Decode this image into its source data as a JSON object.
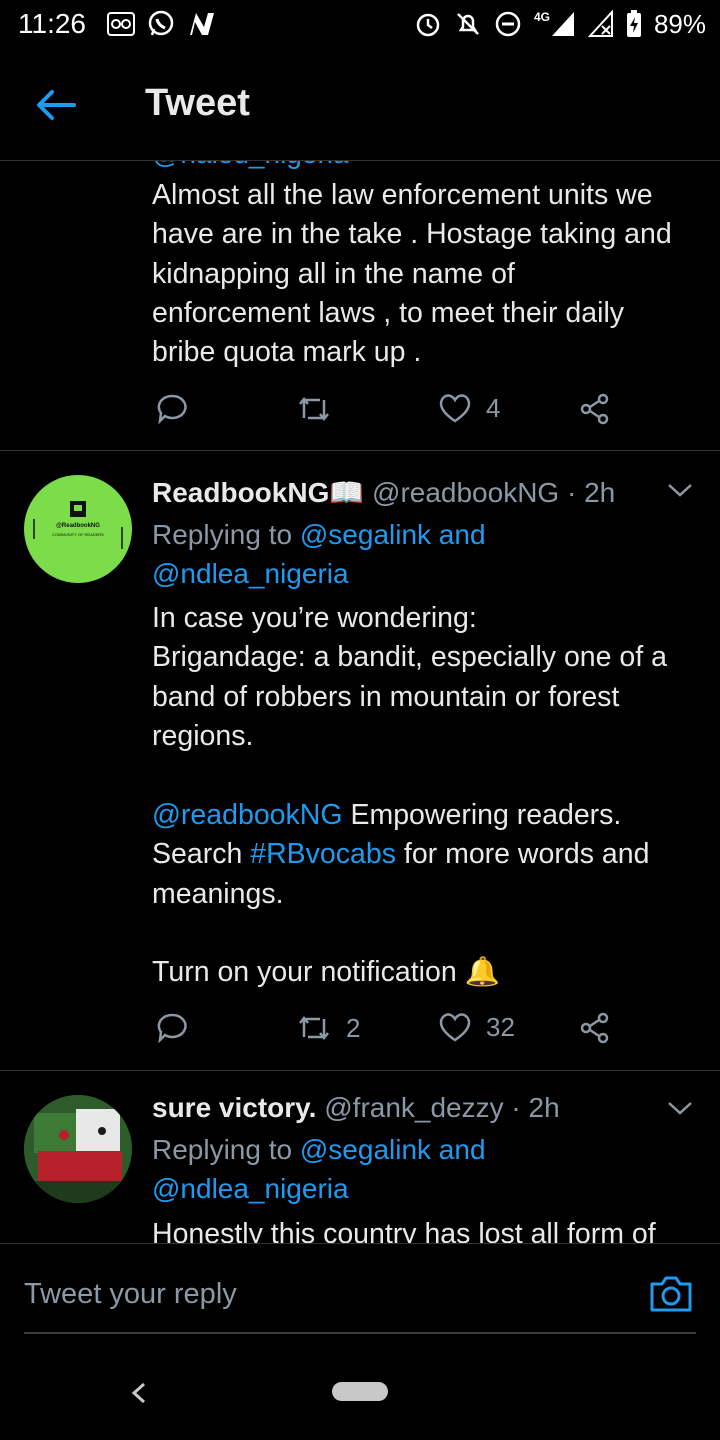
{
  "status_bar": {
    "time": "11:26",
    "network": "4G",
    "battery": "89%"
  },
  "header": {
    "title": "Tweet"
  },
  "tweets": [
    {
      "handle_partial": "@naled_nigeria",
      "text": "Almost all the law enforcement units we\nhave are in the take . Hostage taking and\nkidnapping all in the name of\nenforcement laws , to meet their daily\nbribe quota mark up .",
      "retweets": "",
      "likes": "4"
    },
    {
      "name": "ReadbookNG",
      "emoji": "📖",
      "handle": "@readbookNG",
      "time": "· 2h",
      "replying_label": "Replying to",
      "replying_users": "@segalink and",
      "replying_users_2": "@ndlea_nigeria",
      "avatar_text": "@ReadbookNG",
      "avatar_sub": "COMMUNITY OF READERS",
      "text_1": "In case you’re wondering:\nBrigandage: a bandit, especially one of a\nband of robbers in mountain or forest\nregions.",
      "mention": "@readbookNG",
      "text_2a": " Empowering readers.",
      "text_2b": "Search ",
      "hashtag": "#RBvocabs",
      "text_2c": " for more words and\nmeanings.",
      "text_3": "Turn on your notification 🔔",
      "retweets": "2",
      "likes": "32"
    },
    {
      "name": "sure victory.",
      "handle": "@frank_dezzy",
      "time": "· 2h",
      "replying_label": "Replying to",
      "replying_users": "@segalink and",
      "replying_users_2": "@ndlea_nigeria",
      "text": "Honestly this country has lost all form of"
    }
  ],
  "reply_bar": {
    "placeholder": "Tweet your reply"
  },
  "colors": {
    "accent": "#1d9bf0",
    "secondary_text": "#8b98a5",
    "avatar_green": "#7ddc4a"
  }
}
